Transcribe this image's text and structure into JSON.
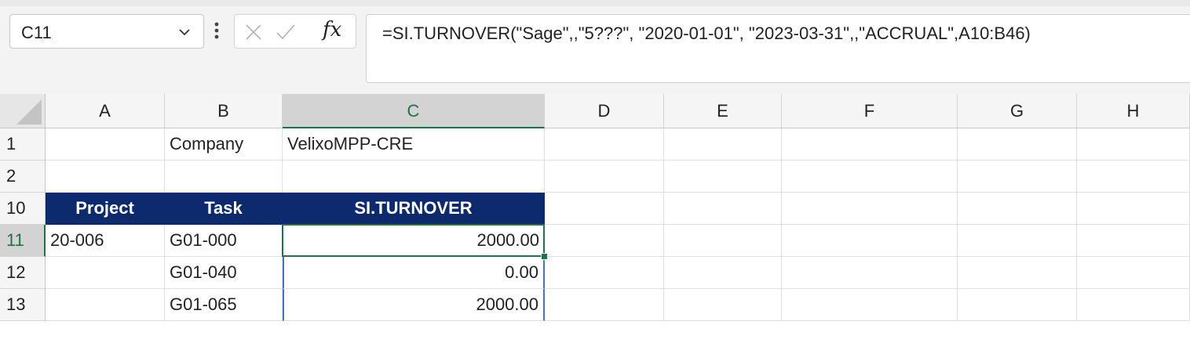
{
  "formula_bar": {
    "name_box": "C11",
    "formula": "=SI.TURNOVER(\"Sage\",,\"5???\", \"2020-01-01\", \"2023-03-31\",,\"ACCRUAL\",A10:B46)"
  },
  "columns": [
    "A",
    "B",
    "C",
    "D",
    "E",
    "F",
    "G",
    "H"
  ],
  "selected_column": "C",
  "rows": [
    {
      "num": "1",
      "A": "",
      "B": "Company",
      "C": "VelixoMPP-CRE"
    },
    {
      "num": "2",
      "A": "",
      "B": "",
      "C": ""
    },
    {
      "num": "10",
      "A": "Project",
      "B": "Task",
      "C": "SI.TURNOVER"
    },
    {
      "num": "11",
      "A": "20-006",
      "B": "G01-000",
      "C": "2000.00"
    },
    {
      "num": "12",
      "A": "",
      "B": "G01-040",
      "C": "0.00"
    },
    {
      "num": "13",
      "A": "",
      "B": "G01-065",
      "C": "2000.00"
    }
  ],
  "selected_row": "11",
  "colors": {
    "accent_green": "#217346",
    "header_fill": "#0e2a6e",
    "range_blue": "#4472c4"
  }
}
